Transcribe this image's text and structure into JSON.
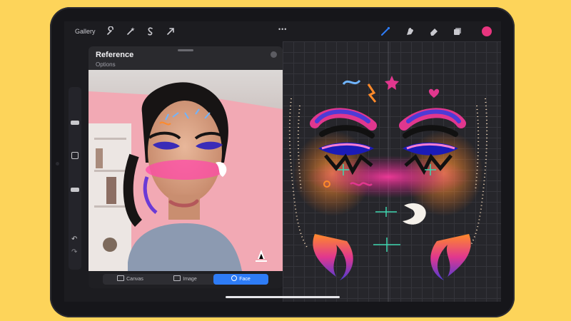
{
  "toolbar": {
    "gallery_label": "Gallery",
    "left_icons": [
      "wrench-icon",
      "magic-wand-icon",
      "selection-icon",
      "transform-arrow-icon"
    ],
    "more_label": "•••",
    "right_icons": [
      "brush-icon",
      "smudge-icon",
      "eraser-icon",
      "layers-icon",
      "color-swatch"
    ],
    "accent_color": "#2e7cf6",
    "swatch_color": "#e8357f"
  },
  "sidebar": {
    "icons": [
      "brush-size-slider",
      "modify-button",
      "opacity-slider",
      "undo-icon",
      "redo-icon"
    ],
    "undo_label": "↶",
    "redo_label": "↷"
  },
  "reference": {
    "title": "Reference",
    "subtitle": "Options",
    "tabs": [
      {
        "label": "Canvas",
        "icon": "canvas-icon"
      },
      {
        "label": "Image",
        "icon": "image-icon"
      },
      {
        "label": "Face",
        "icon": "face-icon",
        "active": true
      }
    ]
  },
  "colors": {
    "background": "#fdd45a",
    "device": "#16161a",
    "canvas_bg": "#26262b"
  }
}
